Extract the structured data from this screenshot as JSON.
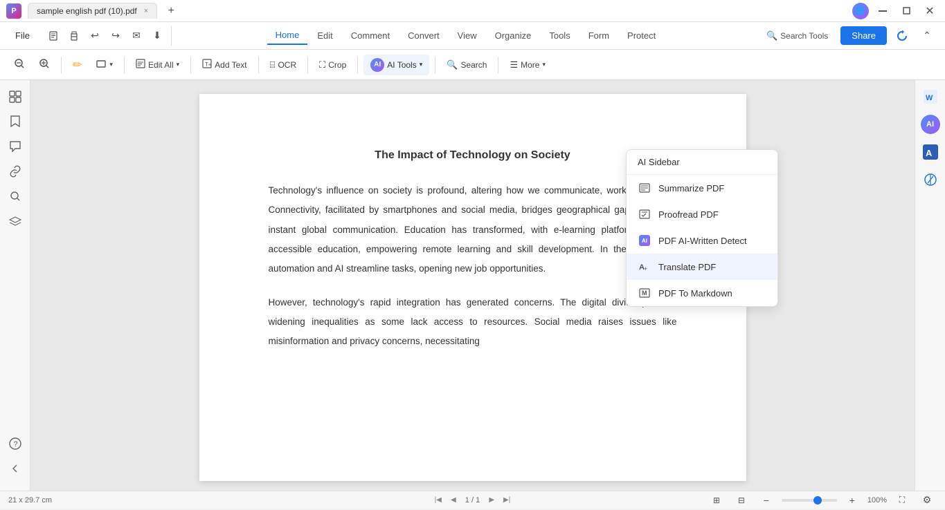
{
  "titlebar": {
    "tab": {
      "label": "sample english pdf (10).pdf",
      "close": "×"
    },
    "add_tab": "+"
  },
  "menubar": {
    "file_label": "File",
    "icons": [
      "🖨",
      "↩",
      "↪",
      "✉",
      "⬇"
    ],
    "tabs": [
      {
        "id": "home",
        "label": "Home",
        "active": true
      },
      {
        "id": "edit",
        "label": "Edit"
      },
      {
        "id": "comment",
        "label": "Comment"
      },
      {
        "id": "convert",
        "label": "Convert"
      },
      {
        "id": "view",
        "label": "View"
      },
      {
        "id": "organize",
        "label": "Organize"
      },
      {
        "id": "tools",
        "label": "Tools"
      },
      {
        "id": "form",
        "label": "Form"
      },
      {
        "id": "protect",
        "label": "Protect"
      }
    ],
    "search_tools_label": "Search Tools",
    "share_label": "Share"
  },
  "toolbar": {
    "zoom_out": "−",
    "zoom_in": "+",
    "highlight": "✏",
    "rectangle": "▭",
    "edit_all": "Edit All",
    "add_text": "Add Text",
    "ocr": "OCR",
    "crop": "Crop",
    "ai_tools": "AI Tools",
    "search": "Search",
    "more": "More"
  },
  "dropdown": {
    "header": "AI Sidebar",
    "items": [
      {
        "id": "summarize",
        "label": "Summarize PDF",
        "icon": "≡"
      },
      {
        "id": "proofread",
        "label": "Proofread PDF",
        "icon": "🖼"
      },
      {
        "id": "ai-detect",
        "label": "PDF AI-Written Detect",
        "icon": "AI"
      },
      {
        "id": "translate",
        "label": "Translate PDF",
        "icon": "A+",
        "active": true
      },
      {
        "id": "markdown",
        "label": "PDF To Markdown",
        "icon": "M"
      }
    ]
  },
  "pdf": {
    "title": "The Impact of Technology on Society",
    "paragraphs": [
      "Technology's influence on society is profound, altering how we communicate, work, and learn. Connectivity, facilitated by smartphones and social media, bridges geographical gaps, enabling instant global communication. Education has transformed, with e-learning platforms offering accessible education, empowering remote learning and skill development. In the workplace, automation and AI streamline tasks, opening new job opportunities.",
      "However, technology's rapid integration has generated concerns. The digital divide persists, widening inequalities as some lack access to resources. Social media raises issues like misinformation and privacy concerns, necessitating"
    ]
  },
  "statusbar": {
    "dimensions": "21 x 29.7 cm",
    "page_info": "1 / 1",
    "zoom_level": "100%"
  }
}
